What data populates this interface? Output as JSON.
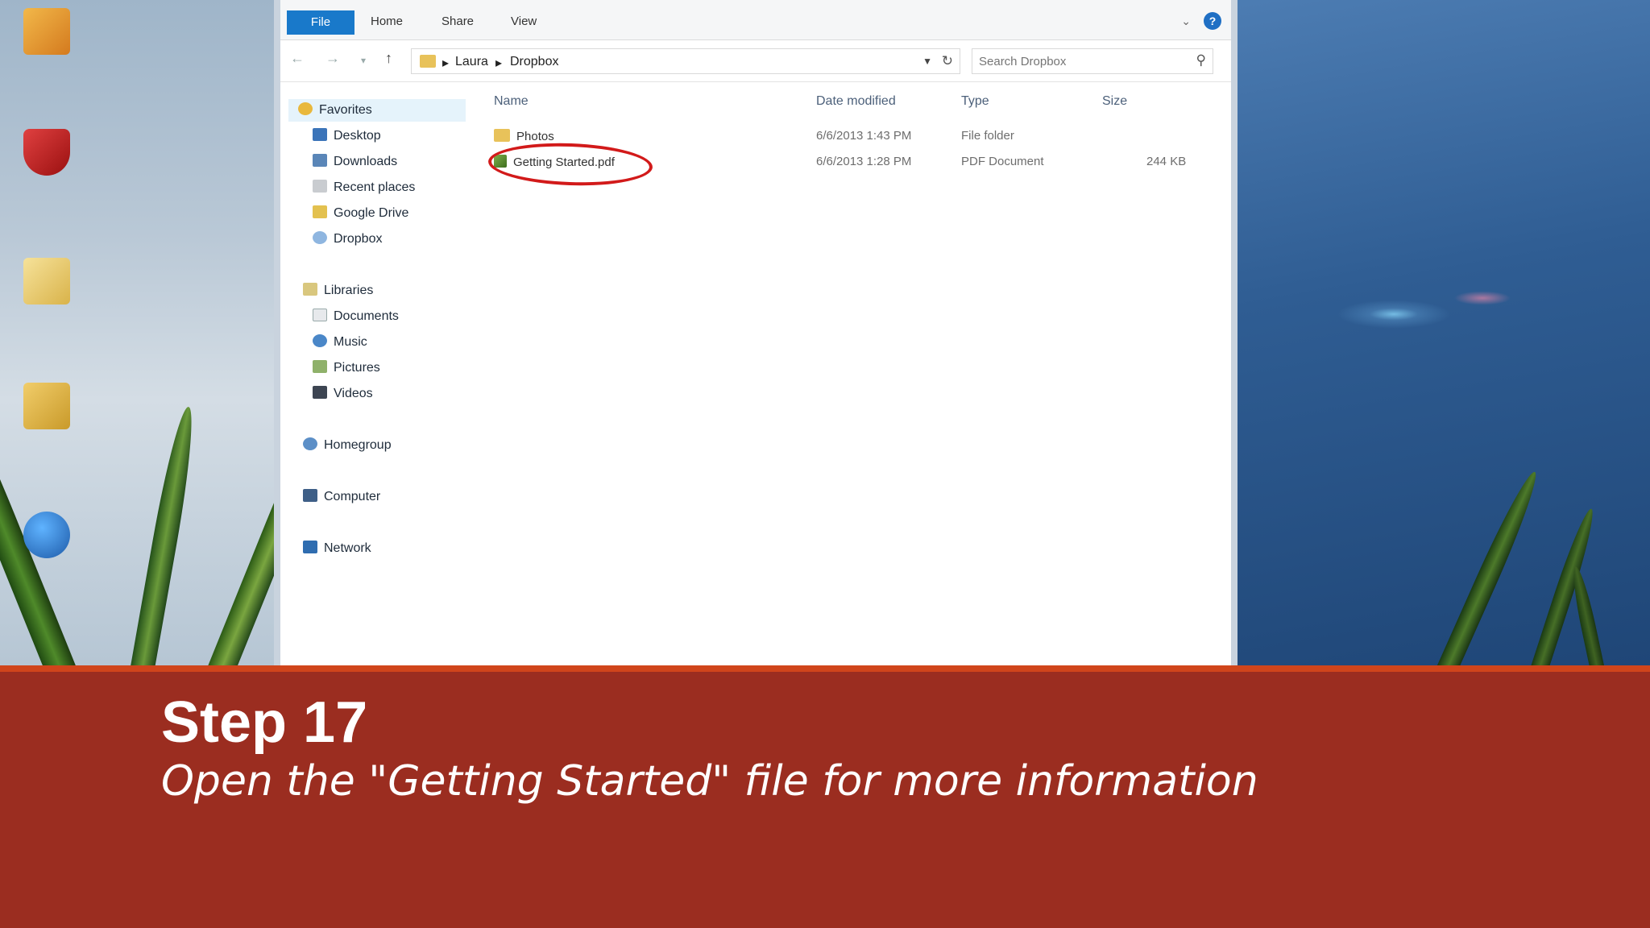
{
  "window": {
    "ribbon_tabs": [
      "File",
      "Home",
      "Share",
      "View"
    ],
    "help_glyph": "?",
    "breadcrumb": [
      "Laura",
      "Dropbox"
    ],
    "search_placeholder": "Search Dropbox"
  },
  "nav_pane": {
    "favorites_header": "Favorites",
    "favorites": [
      "Desktop",
      "Downloads",
      "Recent places",
      "Google Drive",
      "Dropbox"
    ],
    "libraries_header": "Libraries",
    "libraries": [
      "Documents",
      "Music",
      "Pictures",
      "Videos"
    ],
    "homegroup": "Homegroup",
    "computer": "Computer",
    "network": "Network"
  },
  "file_list": {
    "columns": [
      "Name",
      "Date modified",
      "Type",
      "Size"
    ],
    "rows": [
      {
        "name": "Photos",
        "date": "6/6/2013 1:43 PM",
        "type": "File folder",
        "size": "",
        "icon": "folder-icon"
      },
      {
        "name": "Getting Started.pdf",
        "date": "6/6/2013 1:28 PM",
        "type": "PDF Document",
        "size": "244 KB",
        "icon": "pdf-icon",
        "highlighted": true
      }
    ]
  },
  "desktop_icons": [
    {
      "name": "office-icon",
      "color": "#e8a33a"
    },
    {
      "name": "mcafee-icon",
      "color": "#c42020"
    },
    {
      "name": "user-folder-icon",
      "color": "#e8cf7a"
    },
    {
      "name": "google-drive-folder-icon",
      "color": "#e0b94a"
    },
    {
      "name": "globe-icon",
      "color": "#2a77c9"
    }
  ],
  "caption": {
    "title": "Step 17",
    "description": "Open the \"Getting Started\" file for more information"
  },
  "colors": {
    "banner": "#9b2d20",
    "banner_accent": "#d0451b",
    "highlight_circle": "#d21a1a",
    "ribbon_file": "#1979ca"
  }
}
